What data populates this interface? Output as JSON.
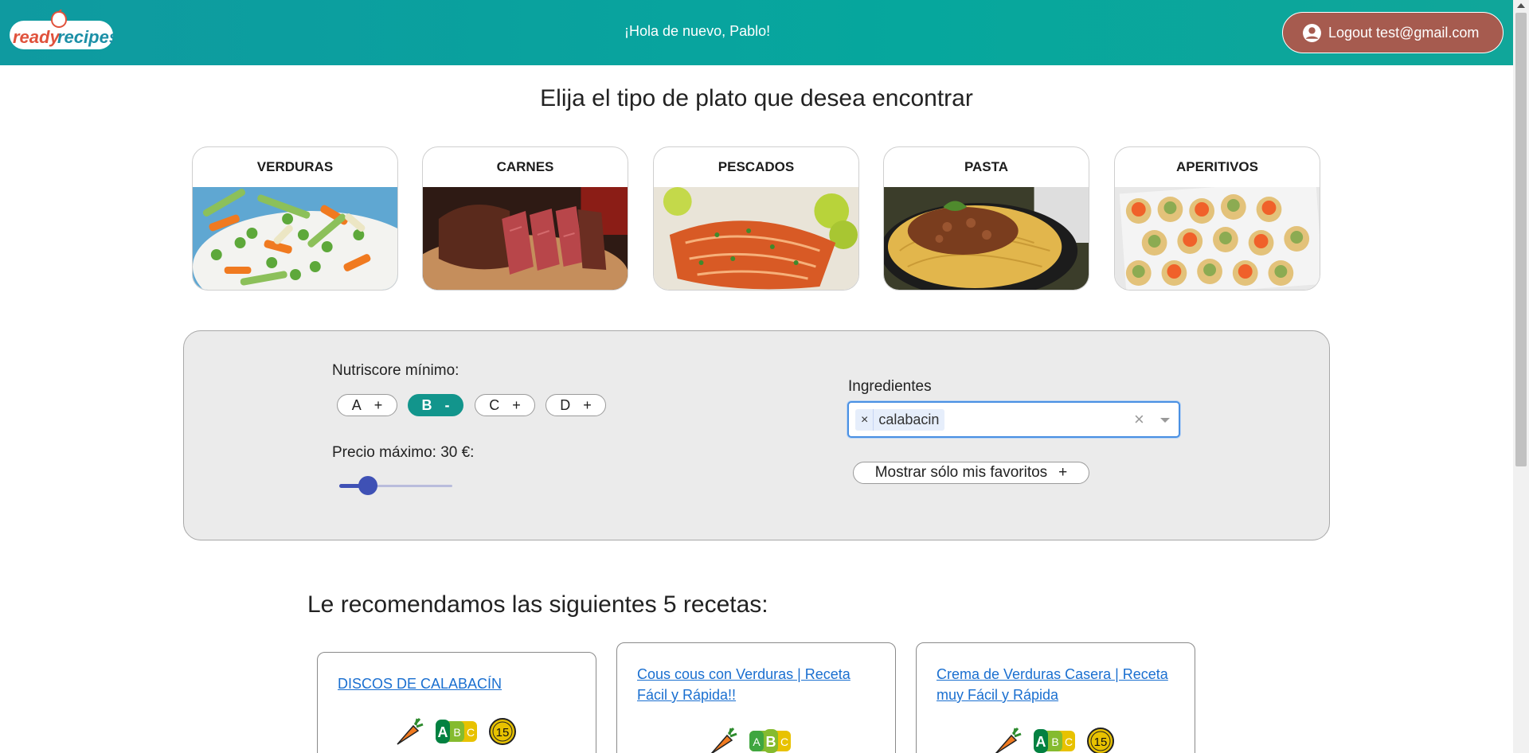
{
  "header": {
    "logo_text": "readyrecipes",
    "greeting": "¡Hola de nuevo, Pablo!",
    "logout_label": "Logout test@gmail.com"
  },
  "heading": "Elija el tipo de plato que desea encontrar",
  "categories": [
    {
      "label": "VERDURAS"
    },
    {
      "label": "CARNES"
    },
    {
      "label": "PESCADOS"
    },
    {
      "label": "PASTA"
    },
    {
      "label": "APERITIVOS"
    }
  ],
  "filters": {
    "nutriscore_label": "Nutriscore mínimo:",
    "nutriscore_options": [
      {
        "letter": "A",
        "sign": "+",
        "active": false
      },
      {
        "letter": "B",
        "sign": "-",
        "active": true
      },
      {
        "letter": "C",
        "sign": "+",
        "active": false
      },
      {
        "letter": "D",
        "sign": "+",
        "active": false
      }
    ],
    "price_label": "Precio máximo: 30 €:",
    "price_slider_fraction": 0.25,
    "ingredients_label": "Ingredientes",
    "selected_ingredient": "calabacin",
    "tag_remove": "×",
    "clear_all": "×",
    "favorites_label": "Mostrar sólo mis favoritos",
    "favorites_sign": "+"
  },
  "recommend_title": "Le recomendamos las siguientes 5 recetas:",
  "recipes": [
    {
      "title": "DISCOS DE CALABACÍN",
      "nutriscore_shown": "A",
      "time": "15"
    },
    {
      "title": "Cous cous con Verduras | Receta Fácil y Rápida!!",
      "nutriscore_shown": "B",
      "time": ""
    },
    {
      "title": "Crema de Verduras Casera | Receta muy Fácil y Rápida",
      "nutriscore_shown": "A",
      "time": "15"
    }
  ],
  "colors": {
    "header_teal": "#06a79d",
    "logout_bg": "#a65b4f",
    "chip_active": "#12958c",
    "slider": "#3f51b5",
    "link": "#1a6fd0"
  }
}
